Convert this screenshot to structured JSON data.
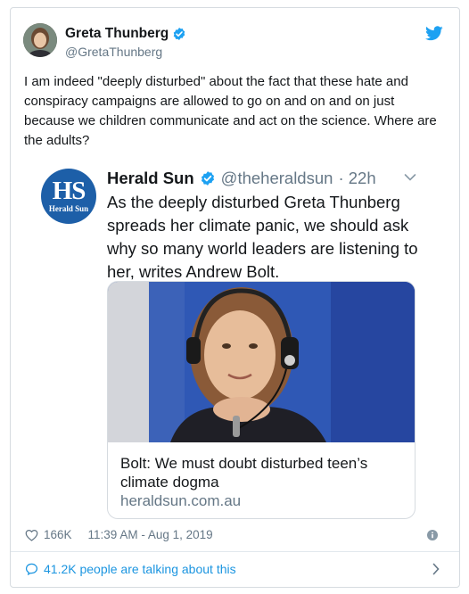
{
  "author": {
    "name": "Greta Thunberg",
    "handle": "@GretaThunberg",
    "verified": true
  },
  "tweet_text": "I am indeed \"deeply disturbed\" about the fact that these hate and conspiracy campaigns are allowed to go on and on and on just because we children communicate and act on the science. Where are the adults?",
  "quoted_tweet": {
    "logo_text": "HS",
    "logo_subtext": "Herald Sun",
    "name": "Herald Sun",
    "handle": "@theheraldsun",
    "time": "· 22h",
    "text": "As the deeply disturbed Greta Thunberg spreads her climate panic, we should ask why so many world leaders are listening to her, writes Andrew Bolt.",
    "link_card": {
      "title": "Bolt: We must doubt disturbed teen’s climate dogma",
      "domain": "heraldsun.com.au"
    }
  },
  "footer": {
    "likes": "166K",
    "timestamp": "11:39 AM - Aug 1, 2019",
    "talking": "41.2K people are talking about this"
  },
  "colors": {
    "accent": "#1da1f2",
    "link": "#1b95e0",
    "muted": "#657786",
    "herald_blue": "#1d5fa8"
  },
  "icons": [
    "verified-badge-icon",
    "twitter-bird-icon",
    "chevron-down-icon",
    "heart-icon",
    "info-icon",
    "speech-bubble-icon",
    "chevron-right-icon"
  ]
}
